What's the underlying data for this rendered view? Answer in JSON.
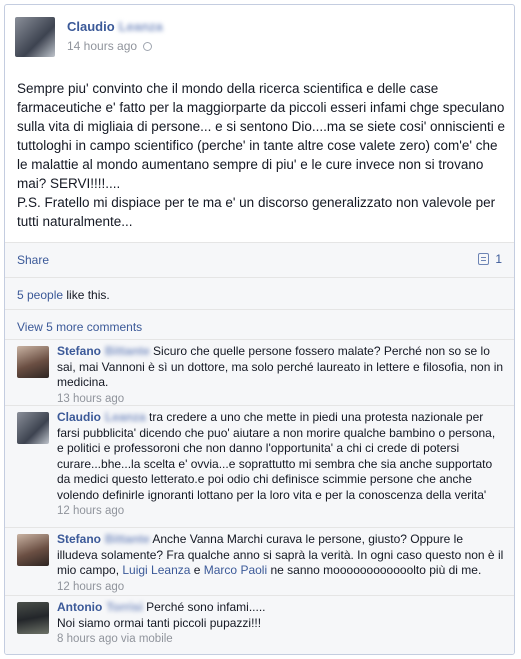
{
  "post": {
    "author_first": "Claudio",
    "author_last": "Leanza",
    "timestamp": "14 hours ago",
    "privacy_icon": "globe-icon",
    "text_lines": [
      "Sempre piu' convinto che il mondo della ricerca scientifica e delle case farmaceutiche e' fatto per la maggiorparte da piccoli esseri infami chge speculano sulla vita di migliaia di persone... e si sentono Dio....ma se siete cosi' onniscienti e tuttologhi in campo scientifico (perche' in tante altre cose valete zero) com'e' che le malattie al mondo aumentano sempre di piu' e le cure invece non si trovano mai? SERVI!!!!....",
      "P.S. Fratello mi dispiace per te ma e' un discorso generalizzato non valevole per tutti naturalmente..."
    ]
  },
  "actions": {
    "share_label": "Share",
    "comment_count": "1"
  },
  "likes": {
    "people_link": "5 people",
    "suffix": " like this."
  },
  "view_more": "View 5 more comments",
  "comments": [
    {
      "first": "Stefano",
      "last": "Bittante",
      "text": "Sicuro che quelle persone fossero malate? Perché non so se lo sai, mai Vannoni è sì un dottore, ma solo perché laureato in lettere e filosofia, non in medicina.",
      "meta": "13 hours ago"
    },
    {
      "first": "Claudio",
      "last": "Leanza",
      "text": "tra credere a uno che mette in piedi una protesta nazionale per farsi pubblicita' dicendo che puo' aiutare a non morire qualche bambino o persona, e politici e professoroni che non danno l'opportunita' a chi ci crede di potersi curare...bhe...la scelta e' ovvia...e soprattutto mi sembra che sia anche supportato da medici questo letterato.e poi odio chi definisce scimmie persone che anche volendo definirle ignoranti lottano per la loro vita e per la conoscenza della verita'",
      "meta": "12 hours ago"
    },
    {
      "first": "Stefano",
      "last": "Bittante",
      "text_before": "Anche Vanna Marchi curava le persone, giusto? Oppure le illudeva solamente? Fra qualche anno si saprà la verità. In ogni caso questo non è il mio campo, ",
      "link1": "Luigi Leanza",
      "text_mid": " e ",
      "link2": "Marco Paoli",
      "text_after": " ne sanno moooooooooooolto più di me.",
      "meta": "12 hours ago"
    },
    {
      "first": "Antonio",
      "last": "Torrisi",
      "text": "Perché sono infami.....",
      "text2": "Noi siamo ormai tanti piccoli pupazzi!!!",
      "meta": "8 hours ago via mobile"
    }
  ]
}
